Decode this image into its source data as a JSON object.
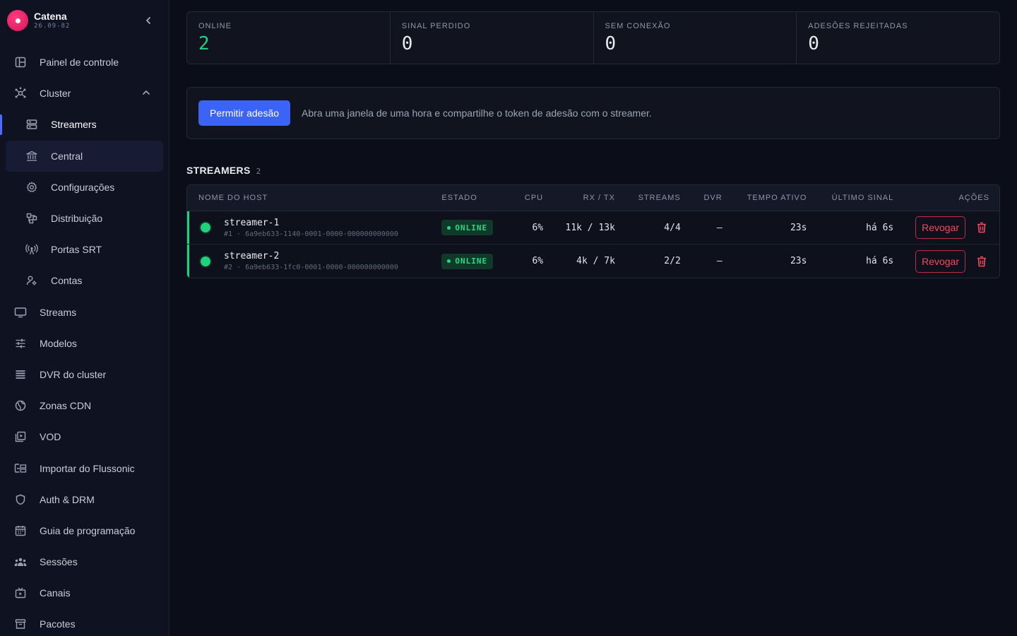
{
  "brand": {
    "name": "Catena",
    "version": "26.09-82"
  },
  "sidebar": {
    "items": [
      {
        "label": "Painel de controle",
        "icon": "dashboard-icon"
      },
      {
        "label": "Cluster",
        "icon": "cluster-icon"
      },
      {
        "label": "Streamers",
        "icon": "server-icon"
      },
      {
        "label": "Central",
        "icon": "bank-icon"
      },
      {
        "label": "Configurações",
        "icon": "gear-icon"
      },
      {
        "label": "Distribuição",
        "icon": "distribution-icon"
      },
      {
        "label": "Portas SRT",
        "icon": "antenna-icon"
      },
      {
        "label": "Contas",
        "icon": "accounts-icon"
      },
      {
        "label": "Streams",
        "icon": "monitor-icon"
      },
      {
        "label": "Modelos",
        "icon": "sliders-icon"
      },
      {
        "label": "DVR do cluster",
        "icon": "list-icon"
      },
      {
        "label": "Zonas CDN",
        "icon": "globe-icon"
      },
      {
        "label": "VOD",
        "icon": "video-library-icon"
      },
      {
        "label": "Importar do Flussonic",
        "icon": "import-icon"
      },
      {
        "label": "Auth & DRM",
        "icon": "shield-icon"
      },
      {
        "label": "Guia de programação",
        "icon": "calendar-icon"
      },
      {
        "label": "Sessões",
        "icon": "people-icon"
      },
      {
        "label": "Canais",
        "icon": "tv-icon"
      },
      {
        "label": "Pacotes",
        "icon": "archive-icon"
      }
    ]
  },
  "stats": [
    {
      "label": "ONLINE",
      "value": "2"
    },
    {
      "label": "SINAL PERDIDO",
      "value": "0"
    },
    {
      "label": "SEM CONEXÃO",
      "value": "0"
    },
    {
      "label": "ADESÕES REJEITADAS",
      "value": "0"
    }
  ],
  "join": {
    "button_label": "Permitir adesão",
    "description": "Abra uma janela de uma hora e compartilhe o token de adesão com o streamer."
  },
  "streamers_section": {
    "title": "STREAMERS",
    "count": "2"
  },
  "table": {
    "headers": [
      "NOME DO HOST",
      "ESTADO",
      "CPU",
      "RX / TX",
      "STREAMS",
      "DVR",
      "TEMPO ATIVO",
      "ÚLTIMO SINAL",
      "AÇÕES"
    ],
    "rows": [
      {
        "host": "streamer-1",
        "id": "#1 · 6a9eb633-1140-0001-0000-000000000000",
        "state": "ONLINE",
        "cpu": "6%",
        "rxtx": "11k / 13k",
        "streams": "4/4",
        "dvr": "—",
        "uptime": "23s",
        "last": "há 6s",
        "revoke": "Revogar"
      },
      {
        "host": "streamer-2",
        "id": "#2 · 6a9eb633-1fc0-0001-0000-000000000000",
        "state": "ONLINE",
        "cpu": "6%",
        "rxtx": "4k / 7k",
        "streams": "2/2",
        "dvr": "—",
        "uptime": "23s",
        "last": "há 6s",
        "revoke": "Revogar"
      }
    ]
  },
  "colors": {
    "accent": "#3b63f6",
    "online": "#22d17b",
    "danger": "#f2495f",
    "brand": "#e8175d"
  }
}
